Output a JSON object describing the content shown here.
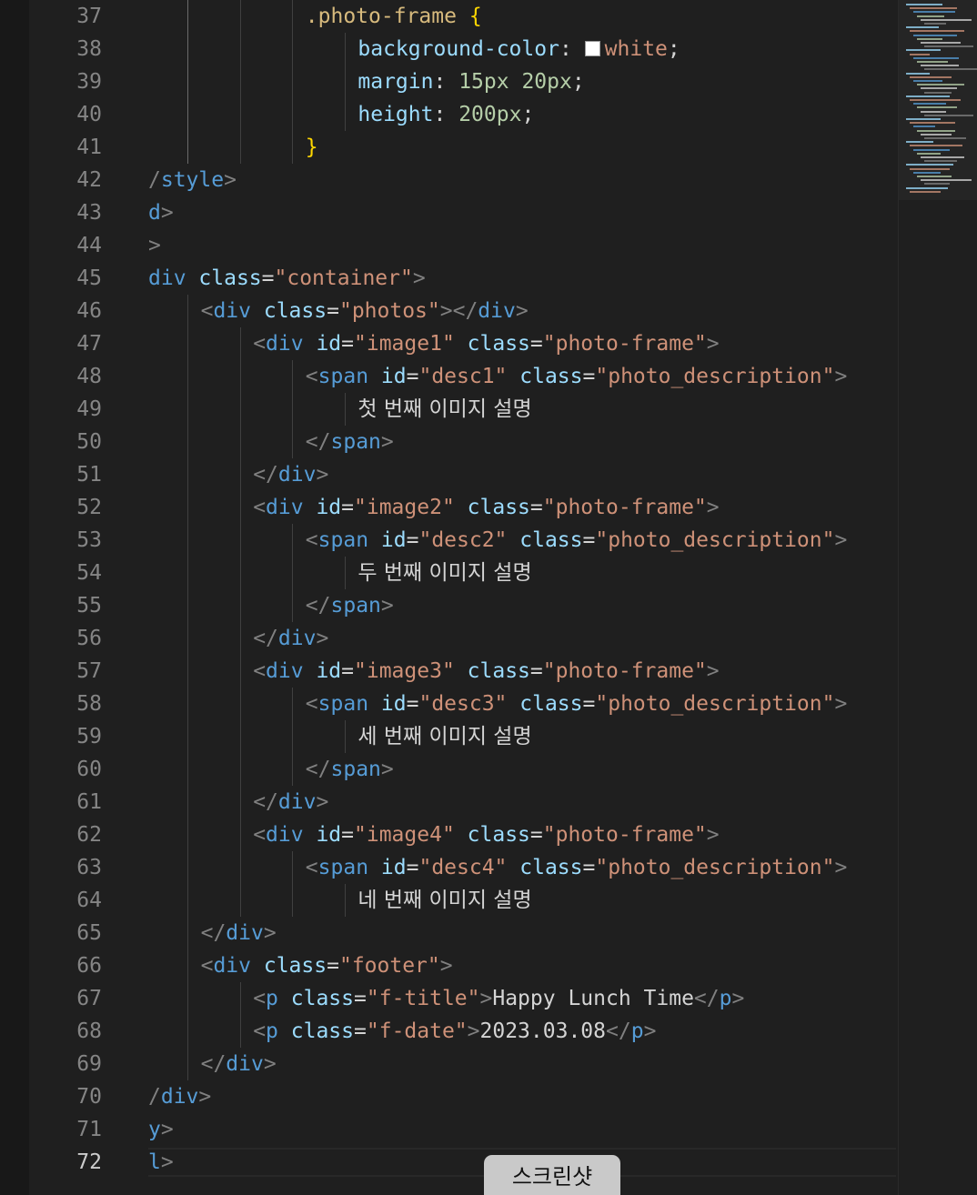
{
  "editor": {
    "line_numbers": [
      "37",
      "38",
      "39",
      "40",
      "41",
      "42",
      "43",
      "44",
      "45",
      "46",
      "47",
      "48",
      "49",
      "50",
      "51",
      "52",
      "53",
      "54",
      "55",
      "56",
      "57",
      "58",
      "59",
      "60",
      "61",
      "62",
      "63",
      "64",
      "65",
      "66",
      "67",
      "68",
      "69",
      "70",
      "71",
      "72"
    ],
    "active_line": "72",
    "color_swatch": "#ffffff",
    "lines": [
      [
        {
          "t": "sel",
          "v": ".photo-frame "
        },
        {
          "t": "brace",
          "v": "{"
        }
      ],
      [
        {
          "t": "prop",
          "v": "background-color"
        },
        {
          "t": "text",
          "v": ": "
        },
        {
          "t": "swatch"
        },
        {
          "t": "val",
          "v": "white"
        },
        {
          "t": "text",
          "v": ";"
        }
      ],
      [
        {
          "t": "prop",
          "v": "margin"
        },
        {
          "t": "text",
          "v": ": "
        },
        {
          "t": "num",
          "v": "15px"
        },
        {
          "t": "text",
          "v": " "
        },
        {
          "t": "num",
          "v": "20px"
        },
        {
          "t": "text",
          "v": ";"
        }
      ],
      [
        {
          "t": "prop",
          "v": "height"
        },
        {
          "t": "text",
          "v": ": "
        },
        {
          "t": "num",
          "v": "200px"
        },
        {
          "t": "text",
          "v": ";"
        }
      ],
      [
        {
          "t": "brace",
          "v": "}"
        }
      ],
      [
        {
          "t": "punct",
          "v": "/"
        },
        {
          "t": "tag",
          "v": "style"
        },
        {
          "t": "punct",
          "v": ">"
        }
      ],
      [
        {
          "t": "tag",
          "v": "d"
        },
        {
          "t": "punct",
          "v": ">"
        }
      ],
      [
        {
          "t": "punct",
          "v": ">"
        }
      ],
      [
        {
          "t": "tag",
          "v": "div"
        },
        {
          "t": "text",
          "v": " "
        },
        {
          "t": "attr",
          "v": "class"
        },
        {
          "t": "text",
          "v": "="
        },
        {
          "t": "str",
          "v": "\"container\""
        },
        {
          "t": "punct",
          "v": ">"
        }
      ],
      [
        {
          "t": "punct",
          "v": "<"
        },
        {
          "t": "tag",
          "v": "div"
        },
        {
          "t": "text",
          "v": " "
        },
        {
          "t": "attr",
          "v": "class"
        },
        {
          "t": "text",
          "v": "="
        },
        {
          "t": "str",
          "v": "\"photos\""
        },
        {
          "t": "punct",
          "v": "></"
        },
        {
          "t": "tag",
          "v": "div"
        },
        {
          "t": "punct",
          "v": ">"
        }
      ],
      [
        {
          "t": "punct",
          "v": "<"
        },
        {
          "t": "tag",
          "v": "div"
        },
        {
          "t": "text",
          "v": " "
        },
        {
          "t": "attr",
          "v": "id"
        },
        {
          "t": "text",
          "v": "="
        },
        {
          "t": "str",
          "v": "\"image1\""
        },
        {
          "t": "text",
          "v": " "
        },
        {
          "t": "attr",
          "v": "class"
        },
        {
          "t": "text",
          "v": "="
        },
        {
          "t": "str",
          "v": "\"photo-frame\""
        },
        {
          "t": "punct",
          "v": ">"
        }
      ],
      [
        {
          "t": "punct",
          "v": "<"
        },
        {
          "t": "tag",
          "v": "span"
        },
        {
          "t": "text",
          "v": " "
        },
        {
          "t": "attr",
          "v": "id"
        },
        {
          "t": "text",
          "v": "="
        },
        {
          "t": "str",
          "v": "\"desc1\""
        },
        {
          "t": "text",
          "v": " "
        },
        {
          "t": "attr",
          "v": "class"
        },
        {
          "t": "text",
          "v": "="
        },
        {
          "t": "str",
          "v": "\"photo_description\""
        },
        {
          "t": "punct",
          "v": ">"
        }
      ],
      [
        {
          "t": "text",
          "v": "첫 번째 이미지 설명"
        }
      ],
      [
        {
          "t": "punct",
          "v": "</"
        },
        {
          "t": "tag",
          "v": "span"
        },
        {
          "t": "punct",
          "v": ">"
        }
      ],
      [
        {
          "t": "punct",
          "v": "</"
        },
        {
          "t": "tag",
          "v": "div"
        },
        {
          "t": "punct",
          "v": ">"
        }
      ],
      [
        {
          "t": "punct",
          "v": "<"
        },
        {
          "t": "tag",
          "v": "div"
        },
        {
          "t": "text",
          "v": " "
        },
        {
          "t": "attr",
          "v": "id"
        },
        {
          "t": "text",
          "v": "="
        },
        {
          "t": "str",
          "v": "\"image2\""
        },
        {
          "t": "text",
          "v": " "
        },
        {
          "t": "attr",
          "v": "class"
        },
        {
          "t": "text",
          "v": "="
        },
        {
          "t": "str",
          "v": "\"photo-frame\""
        },
        {
          "t": "punct",
          "v": ">"
        }
      ],
      [
        {
          "t": "punct",
          "v": "<"
        },
        {
          "t": "tag",
          "v": "span"
        },
        {
          "t": "text",
          "v": " "
        },
        {
          "t": "attr",
          "v": "id"
        },
        {
          "t": "text",
          "v": "="
        },
        {
          "t": "str",
          "v": "\"desc2\""
        },
        {
          "t": "text",
          "v": " "
        },
        {
          "t": "attr",
          "v": "class"
        },
        {
          "t": "text",
          "v": "="
        },
        {
          "t": "str",
          "v": "\"photo_description\""
        },
        {
          "t": "punct",
          "v": ">"
        }
      ],
      [
        {
          "t": "text",
          "v": "두 번째 이미지 설명"
        }
      ],
      [
        {
          "t": "punct",
          "v": "</"
        },
        {
          "t": "tag",
          "v": "span"
        },
        {
          "t": "punct",
          "v": ">"
        }
      ],
      [
        {
          "t": "punct",
          "v": "</"
        },
        {
          "t": "tag",
          "v": "div"
        },
        {
          "t": "punct",
          "v": ">"
        }
      ],
      [
        {
          "t": "punct",
          "v": "<"
        },
        {
          "t": "tag",
          "v": "div"
        },
        {
          "t": "text",
          "v": " "
        },
        {
          "t": "attr",
          "v": "id"
        },
        {
          "t": "text",
          "v": "="
        },
        {
          "t": "str",
          "v": "\"image3\""
        },
        {
          "t": "text",
          "v": " "
        },
        {
          "t": "attr",
          "v": "class"
        },
        {
          "t": "text",
          "v": "="
        },
        {
          "t": "str",
          "v": "\"photo-frame\""
        },
        {
          "t": "punct",
          "v": ">"
        }
      ],
      [
        {
          "t": "punct",
          "v": "<"
        },
        {
          "t": "tag",
          "v": "span"
        },
        {
          "t": "text",
          "v": " "
        },
        {
          "t": "attr",
          "v": "id"
        },
        {
          "t": "text",
          "v": "="
        },
        {
          "t": "str",
          "v": "\"desc3\""
        },
        {
          "t": "text",
          "v": " "
        },
        {
          "t": "attr",
          "v": "class"
        },
        {
          "t": "text",
          "v": "="
        },
        {
          "t": "str",
          "v": "\"photo_description\""
        },
        {
          "t": "punct",
          "v": ">"
        }
      ],
      [
        {
          "t": "text",
          "v": "세 번째 이미지 설명"
        }
      ],
      [
        {
          "t": "punct",
          "v": "</"
        },
        {
          "t": "tag",
          "v": "span"
        },
        {
          "t": "punct",
          "v": ">"
        }
      ],
      [
        {
          "t": "punct",
          "v": "</"
        },
        {
          "t": "tag",
          "v": "div"
        },
        {
          "t": "punct",
          "v": ">"
        }
      ],
      [
        {
          "t": "punct",
          "v": "<"
        },
        {
          "t": "tag",
          "v": "div"
        },
        {
          "t": "text",
          "v": " "
        },
        {
          "t": "attr",
          "v": "id"
        },
        {
          "t": "text",
          "v": "="
        },
        {
          "t": "str",
          "v": "\"image4\""
        },
        {
          "t": "text",
          "v": " "
        },
        {
          "t": "attr",
          "v": "class"
        },
        {
          "t": "text",
          "v": "="
        },
        {
          "t": "str",
          "v": "\"photo-frame\""
        },
        {
          "t": "punct",
          "v": ">"
        }
      ],
      [
        {
          "t": "punct",
          "v": "<"
        },
        {
          "t": "tag",
          "v": "span"
        },
        {
          "t": "text",
          "v": " "
        },
        {
          "t": "attr",
          "v": "id"
        },
        {
          "t": "text",
          "v": "="
        },
        {
          "t": "str",
          "v": "\"desc4\""
        },
        {
          "t": "text",
          "v": " "
        },
        {
          "t": "attr",
          "v": "class"
        },
        {
          "t": "text",
          "v": "="
        },
        {
          "t": "str",
          "v": "\"photo_description\""
        },
        {
          "t": "punct",
          "v": ">"
        }
      ],
      [
        {
          "t": "text",
          "v": "네 번째 이미지 설명"
        }
      ],
      [
        {
          "t": "punct",
          "v": "</"
        },
        {
          "t": "tag",
          "v": "div"
        },
        {
          "t": "punct",
          "v": ">"
        }
      ],
      [
        {
          "t": "punct",
          "v": "<"
        },
        {
          "t": "tag",
          "v": "div"
        },
        {
          "t": "text",
          "v": " "
        },
        {
          "t": "attr",
          "v": "class"
        },
        {
          "t": "text",
          "v": "="
        },
        {
          "t": "str",
          "v": "\"footer\""
        },
        {
          "t": "punct",
          "v": ">"
        }
      ],
      [
        {
          "t": "punct",
          "v": "<"
        },
        {
          "t": "tag",
          "v": "p"
        },
        {
          "t": "text",
          "v": " "
        },
        {
          "t": "attr",
          "v": "class"
        },
        {
          "t": "text",
          "v": "="
        },
        {
          "t": "str",
          "v": "\"f-title\""
        },
        {
          "t": "punct",
          "v": ">"
        },
        {
          "t": "text",
          "v": "Happy Lunch Time"
        },
        {
          "t": "punct",
          "v": "</"
        },
        {
          "t": "tag",
          "v": "p"
        },
        {
          "t": "punct",
          "v": ">"
        }
      ],
      [
        {
          "t": "punct",
          "v": "<"
        },
        {
          "t": "tag",
          "v": "p"
        },
        {
          "t": "text",
          "v": " "
        },
        {
          "t": "attr",
          "v": "class"
        },
        {
          "t": "text",
          "v": "="
        },
        {
          "t": "str",
          "v": "\"f-date\""
        },
        {
          "t": "punct",
          "v": ">"
        },
        {
          "t": "text",
          "v": "2023.03.08"
        },
        {
          "t": "punct",
          "v": "</"
        },
        {
          "t": "tag",
          "v": "p"
        },
        {
          "t": "punct",
          "v": ">"
        }
      ],
      [
        {
          "t": "punct",
          "v": "</"
        },
        {
          "t": "tag",
          "v": "div"
        },
        {
          "t": "punct",
          "v": ">"
        }
      ],
      [
        {
          "t": "punct",
          "v": "/"
        },
        {
          "t": "tag",
          "v": "div"
        },
        {
          "t": "punct",
          "v": ">"
        }
      ],
      [
        {
          "t": "tag",
          "v": "y"
        },
        {
          "t": "punct",
          "v": ">"
        }
      ],
      [
        {
          "t": "tag",
          "v": "l"
        },
        {
          "t": "punct",
          "v": ">"
        }
      ]
    ]
  },
  "screenshot_button": {
    "label": "스크린샷"
  }
}
